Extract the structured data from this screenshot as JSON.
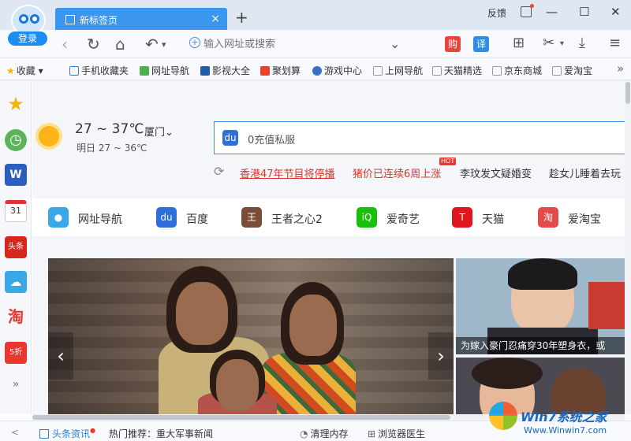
{
  "titlebar": {
    "login_label": "登录",
    "tab_title": "新标签页",
    "tab_close": "×",
    "new_tab": "+",
    "feedback": "反馈",
    "min": "—",
    "max": "☐",
    "close": "✕"
  },
  "navbar": {
    "back": "‹",
    "refresh": "↻",
    "home": "⌂",
    "undo": "↶",
    "undo_menu": "▾",
    "address_placeholder": "输入网址或搜索",
    "address_drop": "⌄",
    "shop_label": "购",
    "translate_label": "译",
    "apps": "⊞",
    "cut": "✂",
    "cut_menu": "▾",
    "download": "⤓",
    "menu": "≡"
  },
  "bookmarks": {
    "star": "★",
    "items": [
      "收藏",
      "手机收藏夹",
      "网址导航",
      "影视大全",
      "聚划算",
      "游戏中心",
      "上网导航",
      "天猫精选",
      "京东商城",
      "爱淘宝"
    ],
    "more": "»"
  },
  "sidebar": {
    "items": [
      "★",
      "◷",
      "W",
      "31",
      "头条",
      "☁",
      "淘",
      "5折"
    ],
    "more": "»"
  },
  "weather": {
    "temp": "27 ~ 37℃",
    "city": "厦门",
    "city_drop": "⌄",
    "tomorrow": "明日 27 ~ 36℃"
  },
  "search": {
    "engine_icon": "du",
    "value": "0充值私服"
  },
  "news": {
    "refresh": "⟳",
    "items": [
      "香港47年节目将停播",
      "猪价已连续6周上涨",
      "李玟发文疑婚变",
      "趁女儿睡着去玩"
    ],
    "hot_badge": "HOT"
  },
  "quicklinks": [
    {
      "label": "网址导航",
      "icon": "●",
      "color": "#3aa7e8"
    },
    {
      "label": "百度",
      "icon": "du",
      "color": "#2f6fd9"
    },
    {
      "label": "王者之心2",
      "icon": "王",
      "color": "#7a4d38"
    },
    {
      "label": "爱奇艺",
      "icon": "iQ",
      "color": "#19c10c"
    },
    {
      "label": "天猫",
      "icon": "T",
      "color": "#e0161f"
    },
    {
      "label": "爱淘宝",
      "icon": "淘",
      "color": "#e34a4a"
    }
  ],
  "slider": {
    "prev": "‹",
    "next": "›",
    "side1_caption": "为嫁入豪门忍痛穿30年塑身衣，或"
  },
  "statusbar": {
    "news_label": "头条资讯",
    "hot_recommend": "热门推荐：重大军事新闻",
    "clean_memory": "清理内存",
    "browser_doctor": "浏览器医生",
    "left_arrow": "<"
  },
  "watermark": {
    "brand": "Win7系统之家",
    "url": "Www.Winwin7.com"
  },
  "colors": {
    "accent": "#3b96f0",
    "news_red": "#d9342b"
  }
}
